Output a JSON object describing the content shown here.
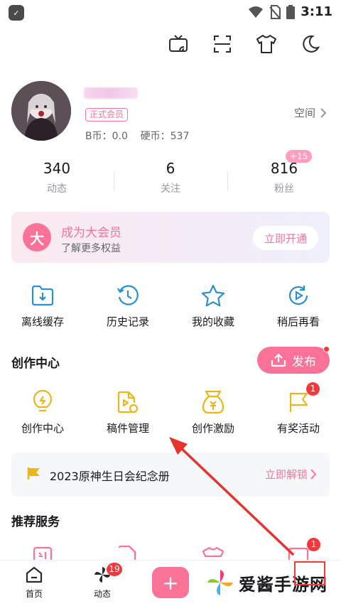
{
  "status_bar": {
    "time": "3:11",
    "app_icon_glyph": "✓"
  },
  "profile": {
    "vip_badge": "正式会员",
    "coins_text": "B币：0.0    硬币：537",
    "space_label": "空间"
  },
  "stats": [
    {
      "num": "340",
      "label": "动态"
    },
    {
      "num": "6",
      "label": "关注"
    },
    {
      "num": "816",
      "label": "粉丝"
    }
  ],
  "fans_badge": "+15",
  "vip_card": {
    "logo": "大",
    "title": "成为大会员",
    "subtitle": "了解更多权益",
    "button": "立即开通"
  },
  "quick_actions": [
    {
      "label": "离线缓存",
      "icon": "download-folder-icon"
    },
    {
      "label": "历史记录",
      "icon": "history-clock-icon"
    },
    {
      "label": "我的收藏",
      "icon": "star-icon"
    },
    {
      "label": "稍后再看",
      "icon": "watch-later-icon"
    }
  ],
  "creator_section": {
    "title": "创作中心",
    "publish_label": "发布",
    "items": [
      {
        "label": "创作中心",
        "icon": "lightbulb-icon"
      },
      {
        "label": "稿件管理",
        "icon": "manuscript-icon"
      },
      {
        "label": "创作激励",
        "icon": "money-bag-icon"
      },
      {
        "label": "有奖活动",
        "icon": "flag-icon",
        "badge": "1"
      }
    ]
  },
  "banner": {
    "text": "2023原神生日会纪念册",
    "link": "立即解锁"
  },
  "recommended": {
    "title": "推荐服务",
    "badge": "1"
  },
  "tabbar": {
    "home_label": "首页",
    "dynamic_label": "动态",
    "dynamic_badge": "19",
    "plus": "+"
  },
  "watermark": {
    "text": "爱酱手游网"
  },
  "colors": {
    "accent": "#fb7299",
    "icon_blue": "#2a8fd6",
    "icon_yellow": "#f1b418",
    "badge_red": "#f5393b"
  }
}
